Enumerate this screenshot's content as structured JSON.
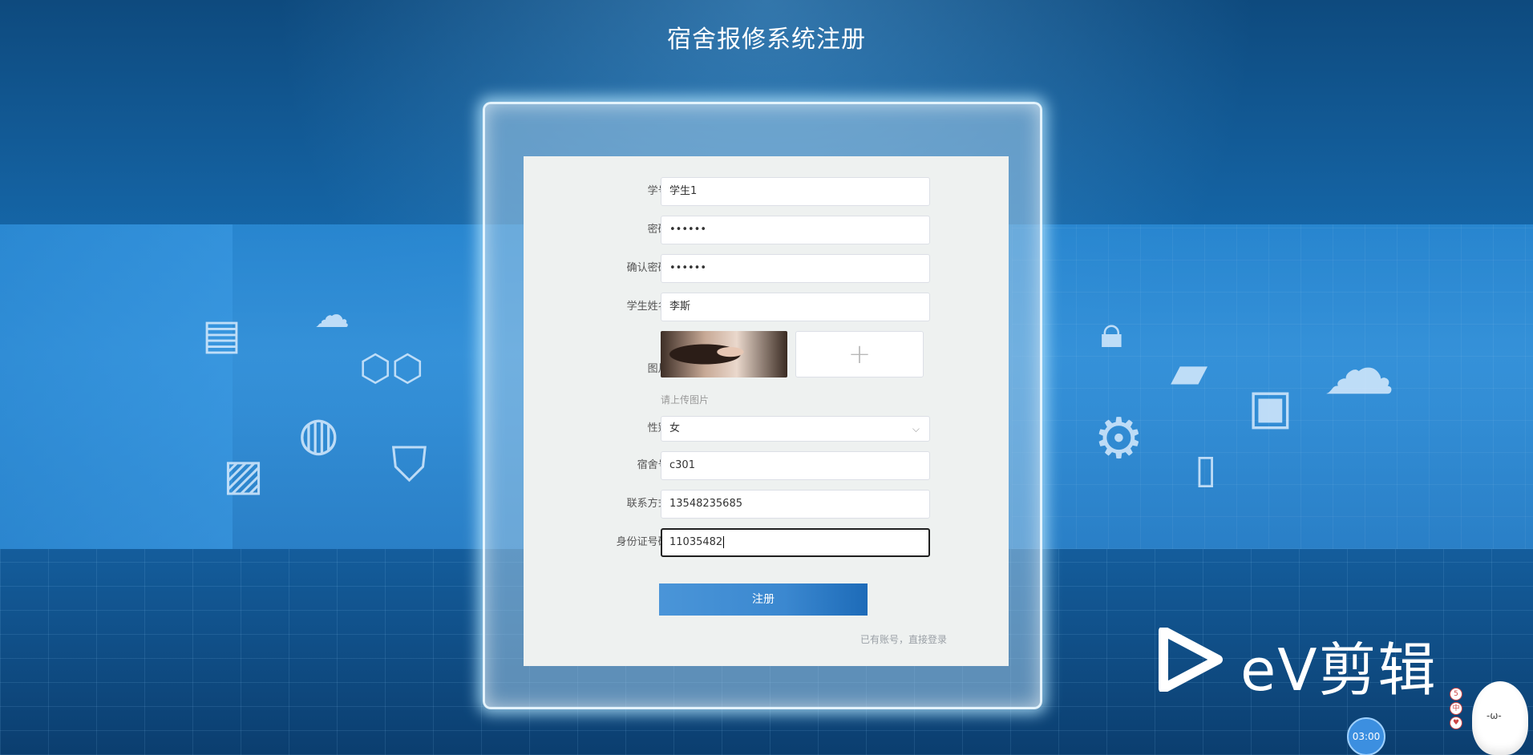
{
  "header": {
    "title": "宿舍报修系统注册"
  },
  "form": {
    "student_id": {
      "label": "学号:",
      "value": "学生1"
    },
    "password": {
      "label": "密码:",
      "value": "••••••"
    },
    "confirm_password": {
      "label": "确认密码:",
      "value": "••••••"
    },
    "student_name": {
      "label": "学生姓名:",
      "value": "李斯"
    },
    "picture": {
      "label": "图片:",
      "upload_hint": "请上传图片",
      "upload_plus": "+"
    },
    "gender": {
      "label": "性别:",
      "value": "女"
    },
    "dorm_number": {
      "label": "宿舍号:",
      "value": "c301"
    },
    "contact": {
      "label": "联系方式:",
      "value": "13548235685"
    },
    "id_number": {
      "label": "身份证号码:",
      "value": "11035482"
    },
    "submit_label": "注册",
    "login_link": "已有账号，直接登录"
  },
  "watermark": {
    "brand": "eV剪辑",
    "timer": "03:00",
    "mascot_face": "-ω-",
    "tool_badges": [
      "5",
      "中",
      "♥"
    ]
  },
  "icons": {
    "gender_dropdown": "chevron-down-icon",
    "upload": "plus-icon"
  },
  "colors": {
    "primary_button": "#3b88d0",
    "background": "#0f4f86",
    "card": "#eef1f0"
  }
}
